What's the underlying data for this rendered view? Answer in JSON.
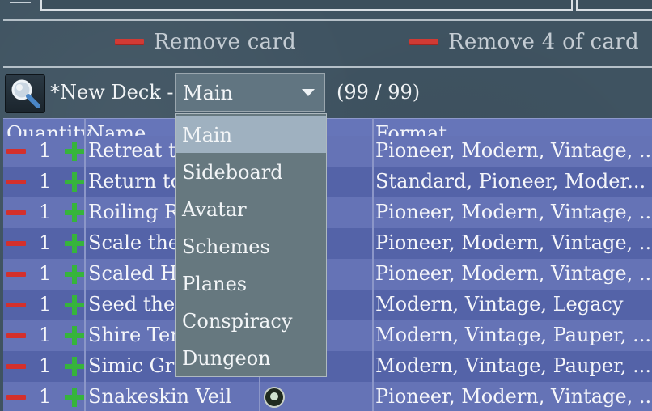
{
  "toolbar": {
    "remove_card": "Remove card",
    "remove_four": "Remove 4 of card"
  },
  "deck": {
    "title": "*New Deck -",
    "section": "Main",
    "count": "(99 / 99)"
  },
  "table": {
    "columns": [
      "Quantity",
      "Name",
      "Format"
    ],
    "rows": [
      {
        "qty": "1",
        "name": "Retreat to",
        "color": "",
        "format": "Pioneer, Modern, Vintage, ..."
      },
      {
        "qty": "1",
        "name": "Return to",
        "color": "",
        "format": "Standard, Pioneer, Moder..."
      },
      {
        "qty": "1",
        "name": "Roiling R",
        "color": "",
        "format": "Pioneer, Modern, Vintage, ..."
      },
      {
        "qty": "1",
        "name": "Scale the",
        "color": "",
        "format": "Pioneer, Modern, Vintage, ..."
      },
      {
        "qty": "1",
        "name": "Scaled He",
        "color": "",
        "format": "Pioneer, Modern, Vintage, ..."
      },
      {
        "qty": "1",
        "name": "Seed the",
        "color": "",
        "format": "Modern, Vintage, Legacy"
      },
      {
        "qty": "1",
        "name": "Shire Ter",
        "color": "",
        "format": "Modern, Vintage, Pauper, ..."
      },
      {
        "qty": "1",
        "name": "Simic Gro",
        "color": "",
        "format": "Modern, Vintage, Pauper, ..."
      },
      {
        "qty": "1",
        "name": "Snakeskin Veil",
        "color": "green-mana-icon",
        "format": "Pioneer, Modern, Vintage, ..."
      }
    ]
  },
  "dropdown": {
    "options": [
      "Main",
      "Sideboard",
      "Avatar",
      "Schemes",
      "Planes",
      "Conspiracy",
      "Dungeon"
    ],
    "selected": "Main"
  },
  "colors": {
    "remove": "#d13a34",
    "add": "#36b43c",
    "table_header": "#6675b9",
    "row_alt": "#5463a8",
    "row_norm": "#6573b6",
    "dropdown_bg": "#66787f",
    "dropdown_selected": "#9fb1c0"
  }
}
